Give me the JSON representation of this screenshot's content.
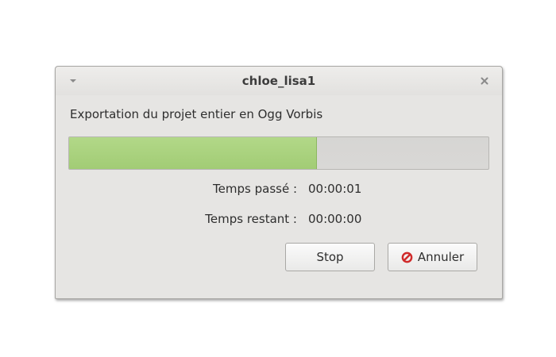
{
  "window": {
    "title": "chloe_lisa1",
    "menu_icon": "chevron-down-icon",
    "close_icon": "close-icon"
  },
  "message": "Exportation du projet entier en Ogg Vorbis",
  "progress": {
    "fraction": 0.59,
    "fill_color": "#a8d07b",
    "track_color": "#d7d6d4"
  },
  "times": {
    "elapsed_label": "Temps passé :",
    "elapsed_value": "00:00:01",
    "remaining_label": "Temps restant :",
    "remaining_value": "00:00:00"
  },
  "buttons": {
    "stop_label": "Stop",
    "cancel_label": "Annuler",
    "cancel_icon": "cancel-icon",
    "cancel_icon_color": "#d02b2b"
  }
}
